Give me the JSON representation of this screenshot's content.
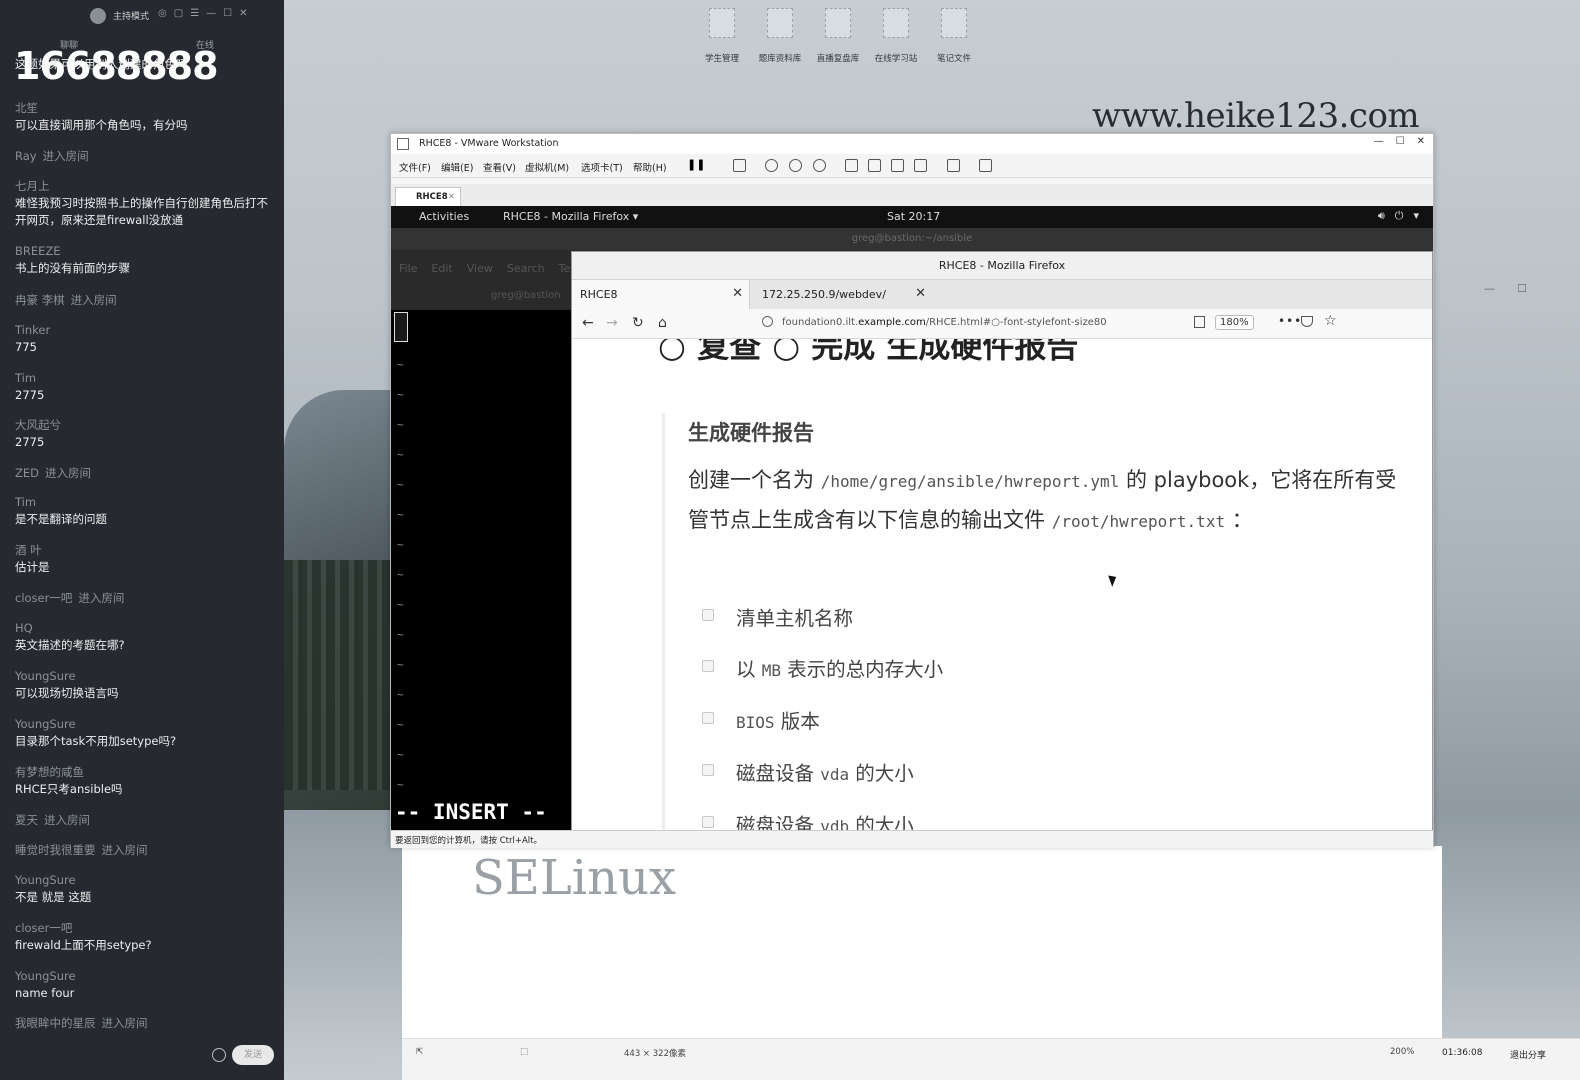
{
  "chat": {
    "host_mode": "主持模式",
    "tabs": [
      "聊聊",
      "在线"
    ],
    "viewer_count": "16688888",
    "messages": [
      {
        "user": "",
        "text": "这题如果可以用别人创建的角色吗",
        "enter": ""
      },
      {
        "user": "北笙",
        "text": "可以直接调用那个角色吗，有分吗",
        "enter": ""
      },
      {
        "user": "Ray",
        "text": "",
        "enter": "进入房间"
      },
      {
        "user": "七月上",
        "text": "难怪我预习时按照书上的操作自行创建角色后打不开网页，原来还是firewall没放通",
        "enter": ""
      },
      {
        "user": "BREEZE",
        "text": "书上的没有前面的步骤",
        "enter": ""
      },
      {
        "user": "冉豪 李棋",
        "text": "",
        "enter": "进入房间"
      },
      {
        "user": "Tinker",
        "text": "775",
        "enter": ""
      },
      {
        "user": "Tim",
        "text": "2775",
        "enter": ""
      },
      {
        "user": "大风起兮",
        "text": "2775",
        "enter": ""
      },
      {
        "user": "ZED",
        "text": "",
        "enter": "进入房间"
      },
      {
        "user": "Tim",
        "text": "是不是翻译的问题",
        "enter": ""
      },
      {
        "user": "酒 叶",
        "text": "估计是",
        "enter": ""
      },
      {
        "user": "closer一吧",
        "text": "",
        "enter": "进入房间"
      },
      {
        "user": "HQ",
        "text": "英文描述的考题在哪?",
        "enter": ""
      },
      {
        "user": "YoungSure",
        "text": "可以现场切换语言吗",
        "enter": ""
      },
      {
        "user": "YoungSure",
        "text": "目录那个task不用加setype吗?",
        "enter": ""
      },
      {
        "user": "有梦想的咸鱼",
        "text": "RHCE只考ansible吗",
        "enter": ""
      },
      {
        "user": "夏天",
        "text": "",
        "enter": "进入房间"
      },
      {
        "user": "睡觉时我很重要",
        "text": "",
        "enter": "进入房间"
      },
      {
        "user": "YoungSure",
        "text": "不是 就是 这题",
        "enter": ""
      },
      {
        "user": "closer一吧",
        "text": "firewald上面不用setype?",
        "enter": ""
      },
      {
        "user": "YoungSure",
        "text": "name four",
        "enter": ""
      },
      {
        "user": "我眼眸中的星辰",
        "text": "",
        "enter": "进入房间"
      }
    ],
    "send_label": "发送"
  },
  "desktop": {
    "shortcuts": [
      "学生管理",
      "题库资料库",
      "直播复盘库",
      "在线学习站",
      "笔记文件"
    ],
    "watermark_url": "www.heike123.com",
    "selinux_text": "SELinux",
    "bottom_bar": {
      "size_label": "443 × 322像素",
      "zoom": "200%"
    },
    "clock": "01:36:08",
    "exit_share": "退出分享"
  },
  "vmware": {
    "title": "RHCE8 - VMware Workstation",
    "menus": [
      "文件(F)",
      "编辑(E)",
      "查看(V)",
      "虚拟机(M)",
      "选项卡(T)",
      "帮助(H)"
    ],
    "tab_label": "RHCE8",
    "status_hint": "要返回到您的计算机，请按 Ctrl+Alt。"
  },
  "gnome": {
    "activities": "Activities",
    "app": "RHCE8 - Mozilla Firefox ▾",
    "clock": "Sat 20:17"
  },
  "terminal": {
    "title": "greg@bastion:~/ansible",
    "menus": [
      "File",
      "Edit",
      "View",
      "Search",
      "Ter"
    ],
    "prompt": "greg@bastion",
    "mode": "-- INSERT --"
  },
  "firefox": {
    "title": "RHCE8 - Mozilla Firefox",
    "tabs": [
      "RHCE8",
      "172.25.250.9/webdev/"
    ],
    "url_prefix": "foundation0.ilt.",
    "url_host": "example.com",
    "url_suffix": "/RHCE.html#○-font-stylefont-size80",
    "zoom": "180%",
    "page": {
      "heading_top": "○ 复查 ○ 完成 生成硬件报告",
      "section_title": "生成硬件报告",
      "para_a": "创建一个名为 ",
      "para_path": "/home/greg/ansible/hwreport.yml",
      "para_b": " 的 playbook，它将在所有受管节点上生成含有以下信息的输出文件 ",
      "para_out": "/root/hwreport.txt",
      "para_c": " ：",
      "items": [
        {
          "pre": "清单主机名称",
          "code": "",
          "post": ""
        },
        {
          "pre": "以 ",
          "code": "MB",
          "post": " 表示的总内存大小"
        },
        {
          "pre": "",
          "code": "BIOS",
          "post": " 版本"
        },
        {
          "pre": "磁盘设备 ",
          "code": "vda",
          "post": " 的大小"
        },
        {
          "pre": "磁盘设备 ",
          "code": "vdb",
          "post": " 的大小"
        }
      ]
    }
  }
}
